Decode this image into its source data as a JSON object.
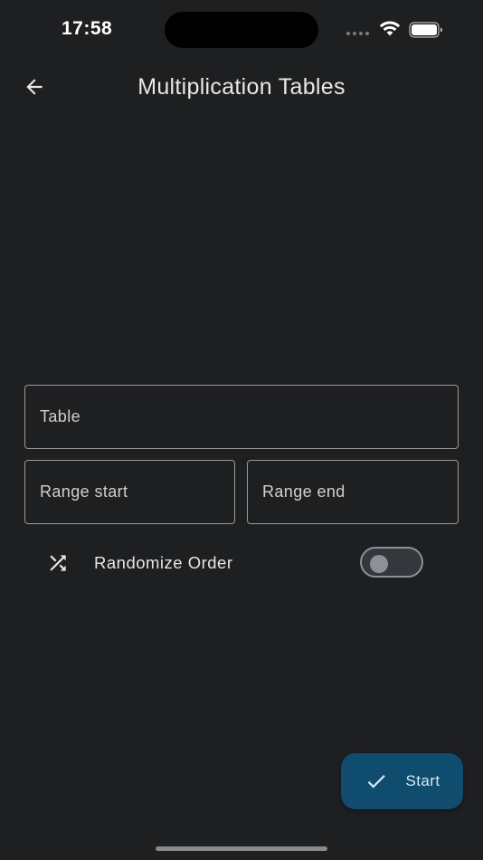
{
  "status_bar": {
    "time": "17:58",
    "wifi_icon": "wifi-icon",
    "battery_icon": "battery-icon"
  },
  "app_bar": {
    "title": "Multiplication Tables",
    "back_icon": "arrow-back-icon"
  },
  "form": {
    "table": {
      "placeholder": "Table",
      "value": ""
    },
    "range_start": {
      "placeholder": "Range start",
      "value": ""
    },
    "range_end": {
      "placeholder": "Range end",
      "value": ""
    },
    "randomize": {
      "icon": "shuffle-icon",
      "label": "Randomize Order",
      "enabled": false
    }
  },
  "fab": {
    "icon": "check-icon",
    "label": "Start",
    "color": "#0f4c6d"
  },
  "colors": {
    "background": "#1e1f21",
    "accent": "#0f4c6d"
  }
}
